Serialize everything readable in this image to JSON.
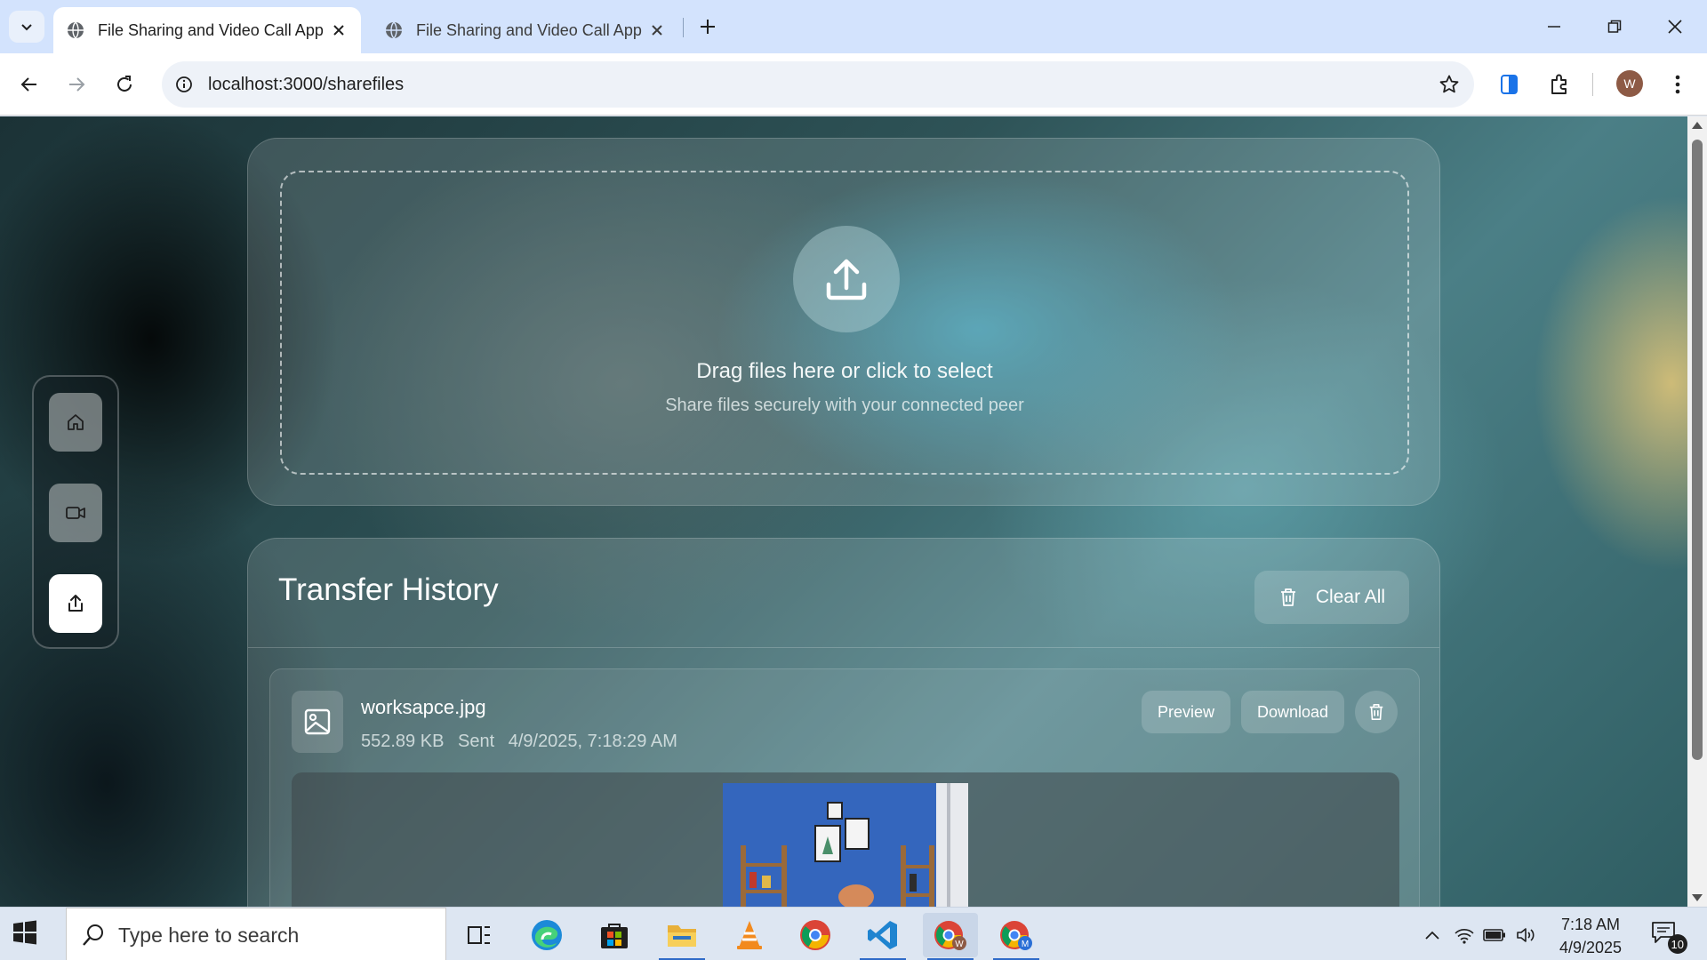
{
  "browser": {
    "tabs": [
      {
        "title": "File Sharing and Video Call App",
        "active": true
      },
      {
        "title": "File Sharing and Video Call App",
        "active": false
      }
    ],
    "url": "localhost:3000/sharefiles",
    "profile_initial": "W"
  },
  "upload": {
    "title": "Drag files here or click to select",
    "subtitle": "Share files securely with your connected peer",
    "icon": "upload-icon"
  },
  "sidebar": {
    "items": [
      {
        "name": "home",
        "icon": "home-icon",
        "active": false
      },
      {
        "name": "video-call",
        "icon": "video-camera-icon",
        "active": false
      },
      {
        "name": "share-files",
        "icon": "share-icon",
        "active": true
      }
    ]
  },
  "history": {
    "title": "Transfer History",
    "clear_label": "Clear All",
    "files": [
      {
        "name": "worksapce.jpg",
        "size": "552.89 KB",
        "direction": "Sent",
        "timestamp": "4/9/2025, 7:18:29 AM",
        "preview_label": "Preview",
        "download_label": "Download"
      }
    ]
  },
  "taskbar": {
    "search_placeholder": "Type here to search",
    "time": "7:18 AM",
    "date": "4/9/2025",
    "notification_count": "10",
    "apps": [
      "task-view-icon",
      "edge-icon",
      "store-icon",
      "file-explorer-icon",
      "vlc-icon",
      "chrome-icon",
      "vscode-icon",
      "chrome-profile-w-icon",
      "chrome-profile-m-icon"
    ]
  },
  "colors": {
    "tabbar": "#d3e3fd",
    "taskbar": "#dde6f2",
    "accent_blue": "#2e6ac8"
  }
}
